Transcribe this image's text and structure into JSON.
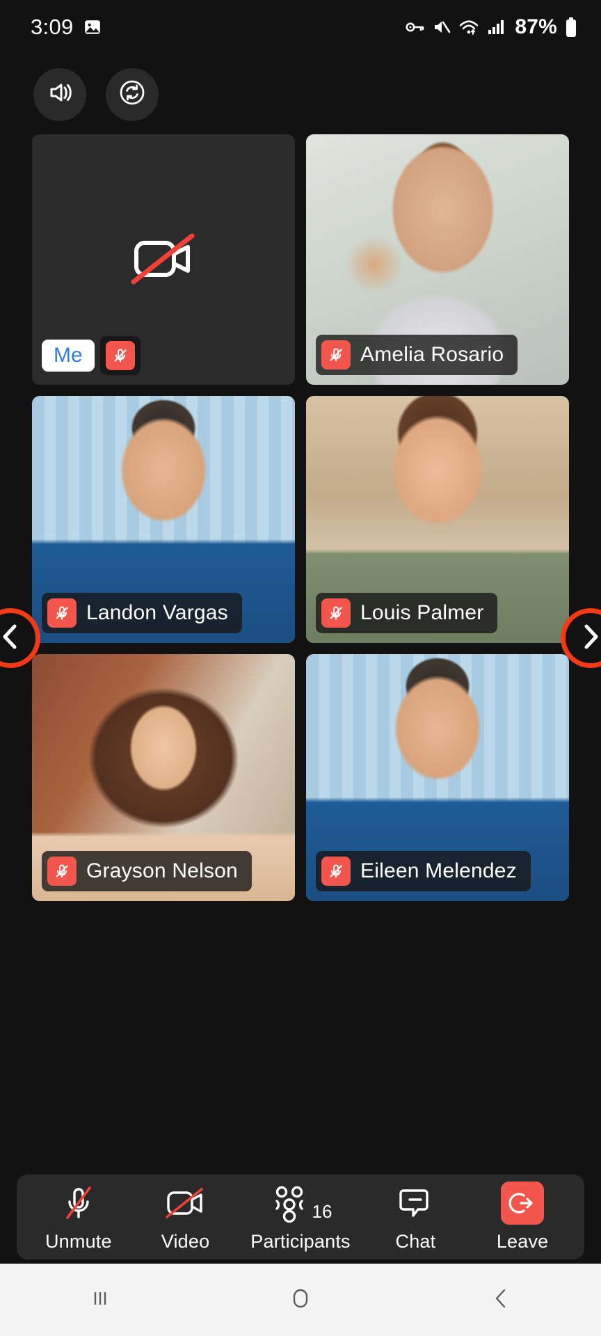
{
  "status_bar": {
    "time": "3:09",
    "battery_percent": "87%",
    "icons": [
      "image-icon",
      "key-icon",
      "speaker-muted-icon",
      "wifi-icon",
      "cellular-signal-icon",
      "battery-icon"
    ]
  },
  "top_controls": [
    {
      "name": "audio-output-button",
      "icon": "speaker-icon"
    },
    {
      "name": "switch-camera-button",
      "icon": "camera-switch-icon"
    }
  ],
  "nav": {
    "prev_label": "chevron-left-icon",
    "next_label": "chevron-right-icon",
    "accent_color": "#f33a16"
  },
  "self_tile": {
    "label": "Me",
    "label_color": "#2f7de1",
    "video_off": true,
    "muted": true,
    "icon": "camera-off-icon"
  },
  "participants": [
    {
      "name": "Amelia Rosario",
      "muted": true,
      "video_class": "v-amelia"
    },
    {
      "name": "Landon Vargas",
      "muted": true,
      "video_class": "v-landon"
    },
    {
      "name": "Louis Palmer",
      "muted": true,
      "video_class": "v-louis"
    },
    {
      "name": "Grayson Nelson",
      "muted": true,
      "video_class": "v-grayson"
    },
    {
      "name": "Eileen Melendez",
      "muted": true,
      "video_class": "v-eileen"
    }
  ],
  "toolbar": {
    "unmute_label": "Unmute",
    "video_label": "Video",
    "participants_label": "Participants",
    "participants_count": "16",
    "chat_label": "Chat",
    "leave_label": "Leave",
    "leave_color": "#f2564d",
    "mute_color": "#f2564d"
  },
  "android_nav": {
    "recents": "recents-icon",
    "home": "home-icon",
    "back": "back-icon"
  }
}
